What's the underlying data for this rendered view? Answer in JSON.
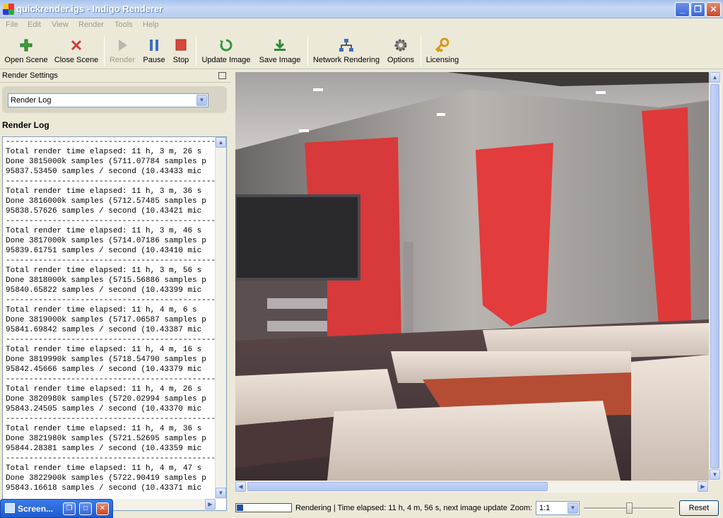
{
  "window": {
    "title": "quickrender.igs - Indigo Renderer"
  },
  "menu": [
    "File",
    "Edit",
    "View",
    "Render",
    "Tools",
    "Help"
  ],
  "toolbar": {
    "open_scene": "Open Scene",
    "close_scene": "Close Scene",
    "render": "Render",
    "pause": "Pause",
    "stop": "Stop",
    "update_image": "Update Image",
    "save_image": "Save Image",
    "network_rendering": "Network Rendering",
    "options": "Options",
    "licensing": "Licensing"
  },
  "panel": {
    "title": "Render Settings",
    "view_select": "Render Log",
    "log_heading": "Render Log"
  },
  "log": {
    "lines": [
      "---------------------------------------------",
      "Total render time elapsed: 11 h, 3 m, 26 s",
      "Done 3815000k samples (5711.07784 samples p",
      "95837.53450 samples / second (10.43433 mic",
      "---------------------------------------------",
      "Total render time elapsed: 11 h, 3 m, 36 s",
      "Done 3816000k samples (5712.57485 samples p",
      "95838.57626 samples / second (10.43421 mic",
      "---------------------------------------------",
      "Total render time elapsed: 11 h, 3 m, 46 s",
      "Done 3817000k samples (5714.07186 samples p",
      "95839.61751 samples / second (10.43410 mic",
      "---------------------------------------------",
      "Total render time elapsed: 11 h, 3 m, 56 s",
      "Done 3818000k samples (5715.56886 samples p",
      "95840.65822 samples / second (10.43399 mic",
      "---------------------------------------------",
      "Total render time elapsed: 11 h, 4 m, 6 s",
      "Done 3819000k samples (5717.06587 samples p",
      "95841.69842 samples / second (10.43387 mic",
      "---------------------------------------------",
      "Total render time elapsed: 11 h, 4 m, 16 s",
      "Done 3819990k samples (5718.54790 samples p",
      "95842.45666 samples / second (10.43379 mic",
      "---------------------------------------------",
      "Total render time elapsed: 11 h, 4 m, 26 s",
      "Done 3820980k samples (5720.02994 samples p",
      "95843.24505 samples / second (10.43370 mic",
      "---------------------------------------------",
      "Total render time elapsed: 11 h, 4 m, 36 s",
      "Done 3821980k samples (5721.52695 samples p",
      "95844.28381 samples / second (10.43359 mic",
      "---------------------------------------------",
      "Total render time elapsed: 11 h, 4 m, 47 s",
      "Done 3822900k samples (5722.90419 samples p",
      "95843.16618 samples / second (10.43371 mic"
    ]
  },
  "taskbar": {
    "label": "Screen..."
  },
  "status": {
    "text": "Rendering | Time elapsed: 11 h, 4 m, 56 s, next image update",
    "progress": 0.12,
    "zoom_label": "Zoom:",
    "zoom_value": "1:1",
    "zoom_slider": 0.5,
    "reset": "Reset"
  },
  "colors": {
    "curtain_red": "#e83c3c",
    "title_text": "#ffffff"
  },
  "icons": [
    "plus-icon",
    "x-icon",
    "play-icon",
    "pause-icon",
    "stop-icon",
    "refresh-icon",
    "download-icon",
    "network-icon",
    "gear-icon",
    "key-icon"
  ]
}
